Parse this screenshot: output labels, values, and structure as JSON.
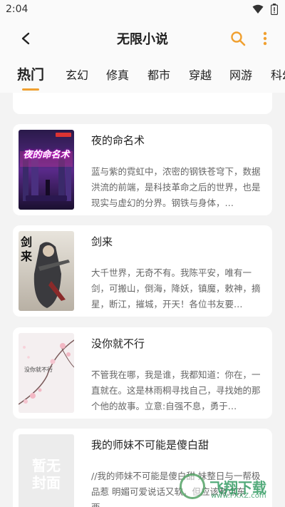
{
  "status_bar": {
    "time": "2:04"
  },
  "app_bar": {
    "title": "无限小说"
  },
  "tabs": [
    {
      "label": "热门",
      "active": true
    },
    {
      "label": "玄幻"
    },
    {
      "label": "修真"
    },
    {
      "label": "都市"
    },
    {
      "label": "穿越"
    },
    {
      "label": "网游"
    },
    {
      "label": "科幻"
    }
  ],
  "books": [
    {
      "title": "夜的命名术",
      "desc": "蓝与紫的霓虹中，浓密的钢铁苍穹下，数据洪流的前端，是科技革命之后的世界，也是现实与虚幻的分界。钢铁与身体，…",
      "cover_text": "夜的命名术"
    },
    {
      "title": "剑来",
      "desc": "大千世界，无奇不有。我陈平安，唯有一剑，可搬山，倒海，降妖，镇魔，敕神，摘星，断江，摧城，开天！各位书友要…",
      "cover_text": "剑来"
    },
    {
      "title": "没你就不行",
      "desc": "不管我在哪，我是谁，我都知道：你在，一直就在。这是林雨桐寻找自己，寻找她的那个他的故事。立意:自强不息，勇于…",
      "cover_text": "没你就不行"
    },
    {
      "title": "我的师妹不可能是傻白甜",
      "desc": "//我的师妹不可能是傻白甜 妹整日与一帮极品惹 明媚可爱说话又软，但应该有点东西。",
      "cover_text": "暂无封面"
    }
  ],
  "watermark": {
    "text": "飞翔下载",
    "url": "www.FXXZ.com"
  },
  "colors": {
    "accent": "#f0a030",
    "background": "#f3f3f3",
    "card": "#ffffff"
  }
}
